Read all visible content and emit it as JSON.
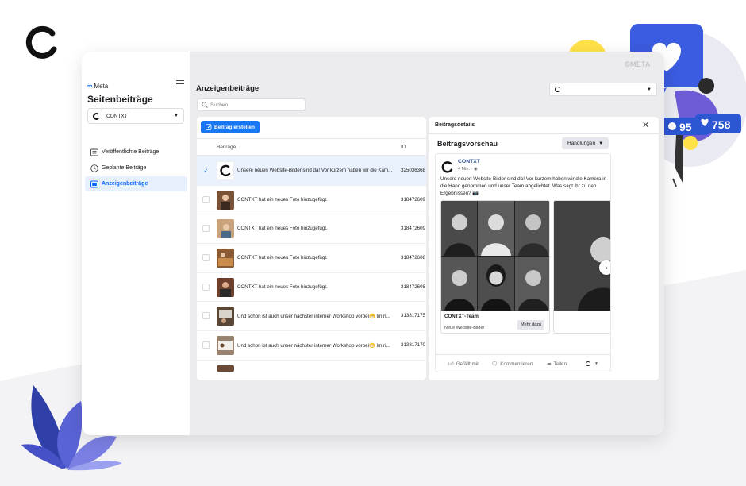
{
  "watermark": "©META",
  "sidebar": {
    "brand": "Meta",
    "title": "Seitenbeiträge",
    "page_selector": "CONTXT",
    "items": [
      {
        "label": "Veröffentlichte Beiträge",
        "icon": "list-icon",
        "active": false
      },
      {
        "label": "Geplante Beiträge",
        "icon": "clock-icon",
        "active": false
      },
      {
        "label": "Anzeigenbeiträge",
        "icon": "ad-icon",
        "active": true
      }
    ]
  },
  "main": {
    "title": "Anzeigenbeiträge",
    "search_placeholder": "Suchen",
    "create_button": "Beitrag erstellen",
    "columns": {
      "posts": "Beiträge",
      "id": "ID"
    },
    "rows": [
      {
        "text": "Unsere neuen Website-Bilder sind da! Vor kurzem haben wir die Kam...",
        "id": "325036368",
        "selected": true
      },
      {
        "text": "CONTXT hat ein neues Foto hinzugefügt.",
        "id": "318472609",
        "selected": false
      },
      {
        "text": "CONTXT hat ein neues Foto hinzugefügt.",
        "id": "318472609",
        "selected": false
      },
      {
        "text": "CONTXT hat ein neues Foto hinzugefügt.",
        "id": "318472608",
        "selected": false
      },
      {
        "text": "CONTXT hat ein neues Foto hinzugefügt.",
        "id": "318472608",
        "selected": false
      },
      {
        "text": "Und schon ist auch unser nächster interner Workshop vorbei😁 Im ri...",
        "id": "313817175",
        "selected": false
      },
      {
        "text": "Und schon ist auch unser nächster interner Workshop vorbei😁 Im ri...",
        "id": "313817170",
        "selected": false
      }
    ]
  },
  "details": {
    "title": "Beitragsdetails",
    "preview_title": "Beitragsvorschau",
    "actions_button": "Handlungen",
    "post": {
      "author": "CONTXT",
      "time": "4 Min.",
      "text": "Unsere neuen Website-Bilder sind da! Vor kurzem haben wir die Kamera in die Hand genommen und unser Team abgelichtet. Was sagt ihr zu den Ergebnissen? 📷",
      "card_title": "CONTXT-Team",
      "card_subtitle": "Neue Website-Bilder",
      "card_button": "Mehr dazu",
      "like": "Gefällt mir",
      "comment": "Kommentieren",
      "share": "Teilen"
    }
  },
  "decor": {
    "likes_count": "95",
    "hearts_count": "758"
  },
  "colors": {
    "accent": "#1877f2",
    "link": "#385898",
    "deco_purple": "#5a63d6",
    "deco_blue": "#1f4fbf"
  }
}
